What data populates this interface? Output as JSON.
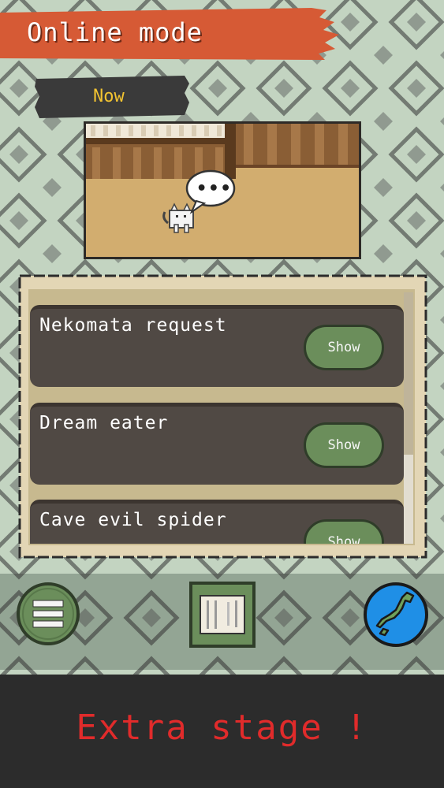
{
  "header": {
    "title": "Online mode"
  },
  "now_label": "Now",
  "scene": {
    "speech": "•••"
  },
  "quests": [
    {
      "name": "Nekomata request",
      "action": "Show"
    },
    {
      "name": "Dream eater",
      "action": "Show"
    },
    {
      "name": "Cave evil spider",
      "action": "Show"
    }
  ],
  "bottom_nav": {
    "menu_icon": "hamburger-icon",
    "journal_icon": "journal-icon",
    "map_icon": "japan-map-icon"
  },
  "footer": {
    "text": "Extra stage !"
  },
  "colors": {
    "title_banner": "#d65a35",
    "now_text": "#f3c431",
    "button_green": "#6b8e5b",
    "extra_text": "#e02b2b",
    "map_blue": "#1f8fe6"
  }
}
